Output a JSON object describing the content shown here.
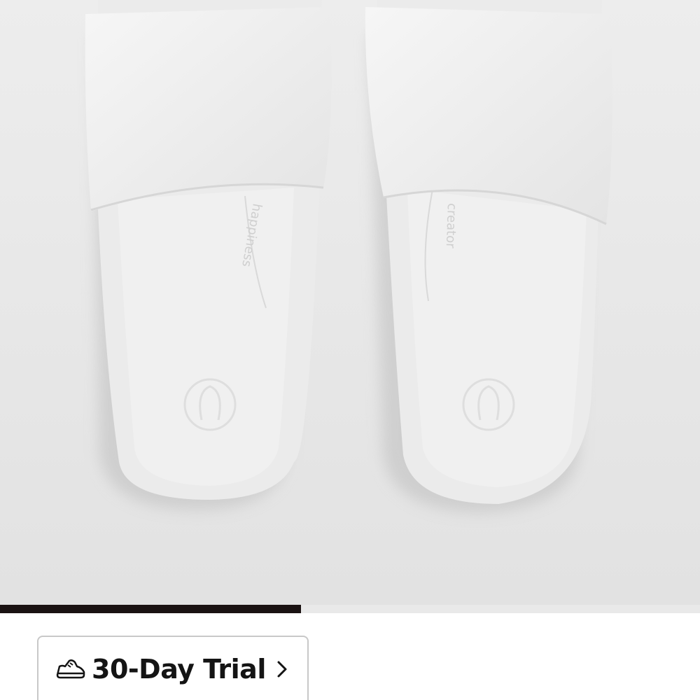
{
  "product": {
    "image_alt": "White slide sandals, top view",
    "left_insole_text": "happiness",
    "right_insole_text": "creator"
  },
  "gallery": {
    "progress": 0.43
  },
  "trial": {
    "label": "30-Day Trial",
    "icon": "sneaker-icon",
    "chevron": "chevron-right-icon"
  },
  "colors": {
    "background": "#e6e6e6",
    "progress_fill": "#1a1212",
    "progress_track": "#e9e9e9",
    "button_border": "#c8c8c8",
    "text": "#141414"
  }
}
